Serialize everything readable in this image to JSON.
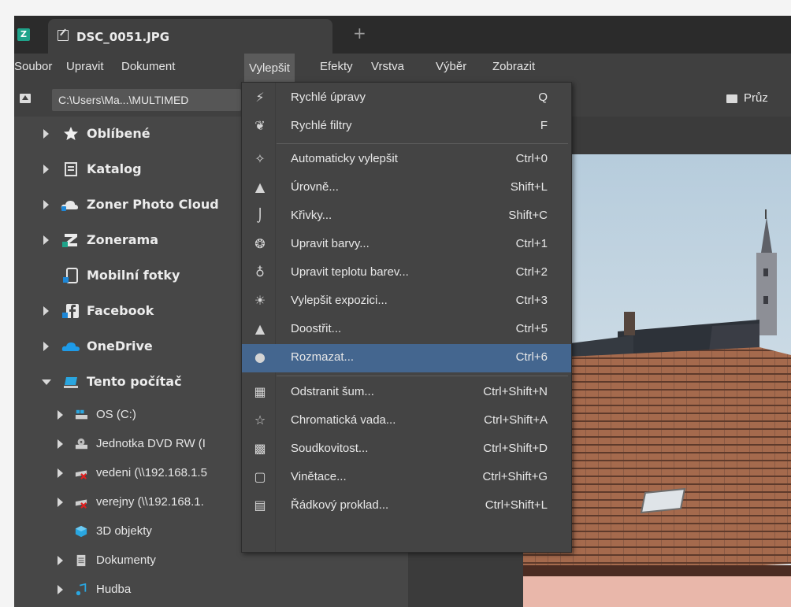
{
  "window": {
    "tab_title": "DSC_0051.JPG",
    "new_tab": "+"
  },
  "menubar": [
    {
      "label": "Soubor"
    },
    {
      "label": "Upravit"
    },
    {
      "label": "Dokument"
    },
    {
      "label": "Vylepšit",
      "active": true
    },
    {
      "label": "Efekty"
    },
    {
      "label": "Vrstva"
    },
    {
      "label": "Výběr"
    },
    {
      "label": "Zobrazit"
    }
  ],
  "toolbar": {
    "path": "C:\\Users\\Ma...\\MULTIMED",
    "right_label": "Průz"
  },
  "sidebar": {
    "items": [
      {
        "label": "Oblíbené",
        "icon": "star-icon",
        "has_arrow": true
      },
      {
        "label": "Katalog",
        "icon": "catalog-icon",
        "has_arrow": true
      },
      {
        "label": "Zoner Photo Cloud",
        "icon": "cloud-icon",
        "has_arrow": true
      },
      {
        "label": "Zonerama",
        "icon": "zonerama-icon",
        "has_arrow": true
      },
      {
        "label": "Mobilní fotky",
        "icon": "mobile-icon",
        "has_arrow": false
      },
      {
        "label": "Facebook",
        "icon": "facebook-icon",
        "has_arrow": true
      },
      {
        "label": "OneDrive",
        "icon": "onedrive-icon",
        "has_arrow": true
      },
      {
        "label": "Tento počítač",
        "icon": "computer-icon",
        "has_arrow": true,
        "expanded": true
      }
    ],
    "subitems": [
      {
        "label": "OS (C:)",
        "icon": "drive-icon",
        "has_arrow": true
      },
      {
        "label": "Jednotka DVD RW (I",
        "icon": "dvd-icon",
        "has_arrow": true
      },
      {
        "label": "vedeni (\\\\192.168.1.5",
        "icon": "network-drive-icon",
        "has_arrow": true
      },
      {
        "label": "verejny (\\\\192.168.1.",
        "icon": "network-drive-icon",
        "has_arrow": true
      },
      {
        "label": "3D objekty",
        "icon": "3d-objects-icon",
        "has_arrow": false
      },
      {
        "label": "Dokumenty",
        "icon": "documents-icon",
        "has_arrow": true
      },
      {
        "label": "Hudba",
        "icon": "music-icon",
        "has_arrow": true
      }
    ]
  },
  "dropdown": {
    "groups": [
      [
        {
          "label": "Rychlé úpravy",
          "shortcut": "Q",
          "icon": "lightning-icon"
        },
        {
          "label": "Rychlé filtry",
          "shortcut": "F",
          "icon": "filters-icon"
        }
      ],
      [
        {
          "label": "Automaticky vylepšit",
          "shortcut": "Ctrl+0",
          "icon": "magic-wand-icon"
        },
        {
          "label": "Úrovně...",
          "shortcut": "Shift+L",
          "icon": "levels-icon"
        },
        {
          "label": "Křivky...",
          "shortcut": "Shift+C",
          "icon": "curves-icon"
        },
        {
          "label": "Upravit barvy...",
          "shortcut": "Ctrl+1",
          "icon": "palette-icon"
        },
        {
          "label": "Upravit teplotu barev...",
          "shortcut": "Ctrl+2",
          "icon": "bulb-icon"
        },
        {
          "label": "Vylepšit expozici...",
          "shortcut": "Ctrl+3",
          "icon": "sun-icon"
        },
        {
          "label": "Doostřit...",
          "shortcut": "Ctrl+5",
          "icon": "sharpen-icon"
        },
        {
          "label": "Rozmazat...",
          "shortcut": "Ctrl+6",
          "icon": "drop-icon",
          "highlighted": true
        }
      ],
      [
        {
          "label": "Odstranit šum...",
          "shortcut": "Ctrl+Shift+N",
          "icon": "noise-icon"
        },
        {
          "label": "Chromatická vada...",
          "shortcut": "Ctrl+Shift+A",
          "icon": "chromatic-icon"
        },
        {
          "label": "Soudkovitost...",
          "shortcut": "Ctrl+Shift+D",
          "icon": "distortion-icon"
        },
        {
          "label": "Vinětace...",
          "shortcut": "Ctrl+Shift+G",
          "icon": "vignette-icon"
        },
        {
          "label": "Řádkový proklad...",
          "shortcut": "Ctrl+Shift+L",
          "icon": "interlace-icon"
        }
      ]
    ]
  },
  "colors": {
    "highlight": "#44668f",
    "menu_bg": "#444444",
    "titlebar": "#2b2b2b",
    "accent_green": "#1fa38a"
  }
}
